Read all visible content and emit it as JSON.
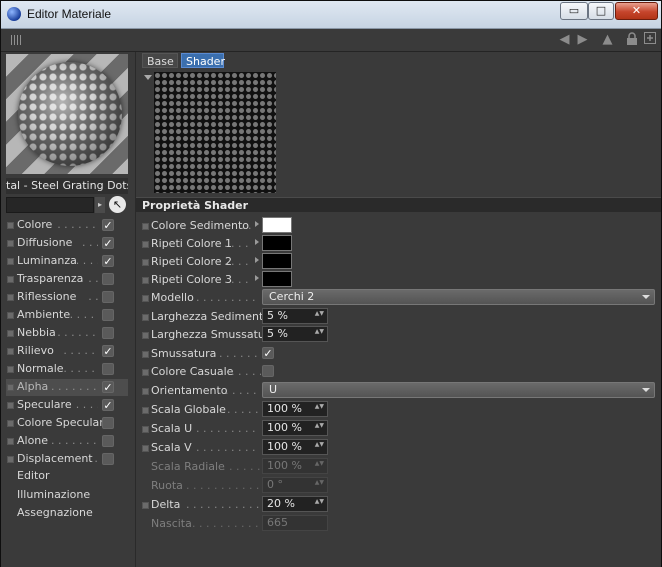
{
  "window": {
    "title": "Editor Materiale",
    "minimize_glyph": "▭",
    "maximize_glyph": "□",
    "close_glyph": "✕"
  },
  "toolbar": {
    "icons": [
      "grip-handle",
      "arrow-left-icon",
      "arrow-right-icon",
      "arrow-up-icon",
      "lock-icon",
      "new-window-icon"
    ]
  },
  "material": {
    "name": "tal - Steel Grating Dots",
    "search_value": "",
    "arrow_glyph": "▸",
    "pick_glyph": "↖"
  },
  "channels": [
    {
      "label": "Colore",
      "lead": ". . . . . . . . .",
      "checked": true
    },
    {
      "label": "Diffusione",
      "lead": ". . . . .",
      "checked": true
    },
    {
      "label": "Luminanza",
      "lead": ". . . . .",
      "checked": true
    },
    {
      "label": "Trasparenza",
      "lead": ". . . .",
      "checked": false
    },
    {
      "label": "Riflessione",
      "lead": ". . . . .",
      "checked": false
    },
    {
      "label": "Ambiente",
      "lead": ". . . . . . .",
      "checked": false
    },
    {
      "label": "Nebbia",
      "lead": ". . . . . . . .",
      "checked": false
    },
    {
      "label": "Rilievo",
      "lead": ". . . . . . . .",
      "checked": true
    },
    {
      "label": "Normale",
      "lead": ". . . . . . .",
      "checked": false
    },
    {
      "label": "Alpha",
      "lead": ". . . . . . . . .",
      "checked": true,
      "selected": true
    },
    {
      "label": "Speculare",
      "lead": ". . . . . .",
      "checked": true
    },
    {
      "label": "Colore Speculare",
      "lead": "",
      "checked": false
    },
    {
      "label": "Alone",
      "lead": ". . . . . . . . .",
      "checked": false
    },
    {
      "label": "Displacement",
      "lead": ". . .",
      "checked": false
    }
  ],
  "pages": [
    "Editor",
    "Illuminazione",
    "Assegnazione"
  ],
  "tabs": {
    "base": "Base",
    "shader": "Shader"
  },
  "section_title": "Proprietà Shader",
  "check_glyph": "✓",
  "spin_glyph": "▲▼",
  "colors": {
    "accent_tab": "#3b6fae",
    "sediment": "#ffffff",
    "repeat1": "#000000",
    "repeat2": "#000000",
    "repeat3": "#000000"
  },
  "props": {
    "colore_sedimento": {
      "label": "Colore Sedimento",
      "lead": ". . ."
    },
    "ripeti_colore_1": {
      "label": "Ripeti Colore 1",
      "lead": ". . . ."
    },
    "ripeti_colore_2": {
      "label": "Ripeti Colore 2",
      "lead": ". . . ."
    },
    "ripeti_colore_3": {
      "label": "Ripeti Colore 3",
      "lead": ". . . ."
    },
    "modello": {
      "label": "Modello",
      "lead": ". . . . . . . . . . . .",
      "value": "Cerchi 2"
    },
    "larghezza_sedimento": {
      "label": "Larghezza Sedimento",
      "lead": "",
      "value": "5 %"
    },
    "larghezza_smussatura": {
      "label": "Larghezza Smussatura",
      "lead": "",
      "value": "5 %"
    },
    "smussatura": {
      "label": "Smussatura",
      "lead": ". . . . . . . .",
      "checked": true
    },
    "colore_casuale": {
      "label": "Colore Casuale",
      "lead": ". . . . . .",
      "checked": false
    },
    "orientamento": {
      "label": "Orientamento",
      "lead": ". . . . . . . .",
      "value": "U"
    },
    "scala_globale": {
      "label": "Scala Globale",
      "lead": ". . . . . . .",
      "value": "100 %"
    },
    "scala_u": {
      "label": "Scala U",
      "lead": ". . . . . . . . . . . .",
      "value": "100 %"
    },
    "scala_v": {
      "label": "Scala V",
      "lead": ". . . . . . . . . . . .",
      "value": "100 %"
    },
    "scala_radiale": {
      "label": "Scala Radiale",
      "lead": ". . . . . . .",
      "value": "100 %"
    },
    "ruota": {
      "label": "Ruota",
      "lead": ". . . . . . . . . . . . . . .",
      "value": "0 °"
    },
    "delta": {
      "label": "Delta",
      "lead": ". . . . . . . . . . . . . . .",
      "value": "20 %"
    },
    "nascita": {
      "label": "Nascita",
      "lead": ". . . . . . . . . . . . .",
      "value": "665"
    }
  }
}
